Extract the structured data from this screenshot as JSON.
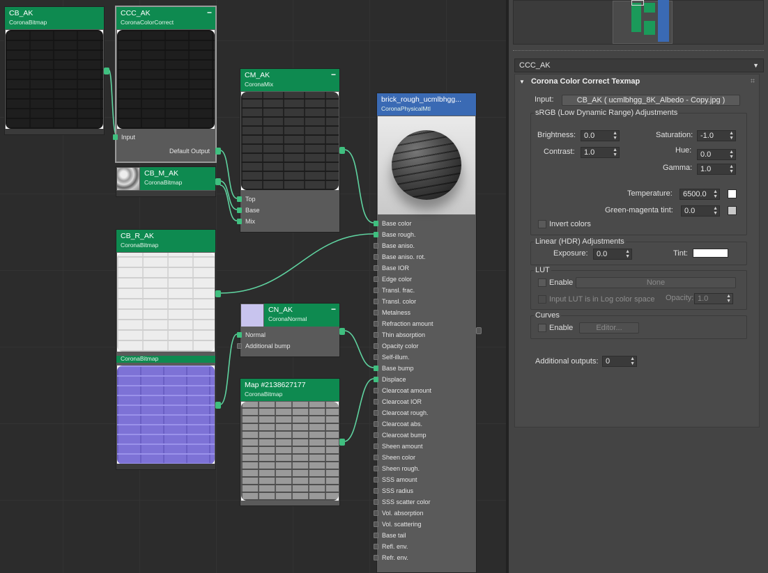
{
  "colors": {
    "node_header": "#0e8a50",
    "material_header": "#3a6ab4",
    "wire": "#5fd3a0",
    "port": "#3fbf7f",
    "panel_bg": "#444444",
    "graph_bg": "#2c2c2c"
  },
  "graph": {
    "nodes": {
      "cb_ak": {
        "title": "CB_AK",
        "type": "CoronaBitmap"
      },
      "ccc_ak": {
        "title": "CCC_AK",
        "type": "CoronaColorCorrect",
        "ports_in": [
          "Input"
        ],
        "ports_out": [
          "Default Output"
        ]
      },
      "cb_m_ak": {
        "title": "CB_M_AK",
        "type": "CoronaBitmap"
      },
      "cm_ak": {
        "title": "CM_AK",
        "type": "CoronaMix",
        "ports_in": [
          "Top",
          "Base",
          "Mix"
        ]
      },
      "cb_r_ak": {
        "title": "CB_R_AK",
        "type": "CoronaBitmap"
      },
      "normal_bitmap": {
        "type": "CoronaBitmap"
      },
      "cn_ak": {
        "title": "CN_AK",
        "type": "CoronaNormal",
        "ports_in": [
          "Normal",
          "Additional bump"
        ]
      },
      "map": {
        "title": "Map #2138627177",
        "type": "CoronaBitmap"
      },
      "material": {
        "title": "brick_rough_ucmlbhgg...",
        "type": "CoronaPhysicalMtl",
        "ports_in": [
          "Base color",
          "Base rough.",
          "Base aniso.",
          "Base aniso. rot.",
          "Base IOR",
          "Edge color",
          "Transl. frac.",
          "Transl. color",
          "Metalness",
          "Refraction amount",
          "Thin absorption",
          "Opacity color",
          "Self-illum.",
          "Base bump",
          "Displace",
          "Clearcoat amount",
          "Clearcoat IOR",
          "Clearcoat rough.",
          "Clearcoat abs.",
          "Clearcoat bump",
          "Sheen amount",
          "Sheen color",
          "Sheen rough.",
          "SSS amount",
          "SSS radius",
          "SSS scatter color",
          "Vol. absorption",
          "Vol. scattering",
          "Base tail",
          "Refl. env.",
          "Refr. env."
        ]
      }
    }
  },
  "panel": {
    "selected_node": "CCC_AK",
    "rollout_title": "Corona Color Correct Texmap",
    "input_label": "Input:",
    "input_map": "CB_AK ( ucmlbhgg_8K_Albedo - Copy.jpg )",
    "srgb": {
      "title": "sRGB (Low Dynamic Range) Adjustments",
      "brightness_label": "Brightness:",
      "brightness": "0.0",
      "saturation_label": "Saturation:",
      "saturation": "-1.0",
      "contrast_label": "Contrast:",
      "contrast": "1.0",
      "hue_label": "Hue:",
      "hue": "0.0",
      "gamma_label": "Gamma:",
      "gamma": "1.0",
      "temperature_label": "Temperature:",
      "temperature": "6500.0",
      "tint_gm_label": "Green-magenta tint:",
      "tint_gm": "0.0",
      "invert_label": "Invert colors"
    },
    "linear": {
      "title": "Linear (HDR) Adjustments",
      "exposure_label": "Exposure:",
      "exposure": "0.0",
      "tint_label": "Tint:"
    },
    "lut": {
      "title": "LUT",
      "enable_label": "Enable",
      "file_button": "None",
      "log_label": "Input LUT is in Log color space",
      "opacity_label": "Opacity:",
      "opacity": "1.0"
    },
    "curves": {
      "title": "Curves",
      "enable_label": "Enable",
      "editor_button": "Editor..."
    },
    "additional_outputs_label": "Additional outputs:",
    "additional_outputs": "0"
  }
}
